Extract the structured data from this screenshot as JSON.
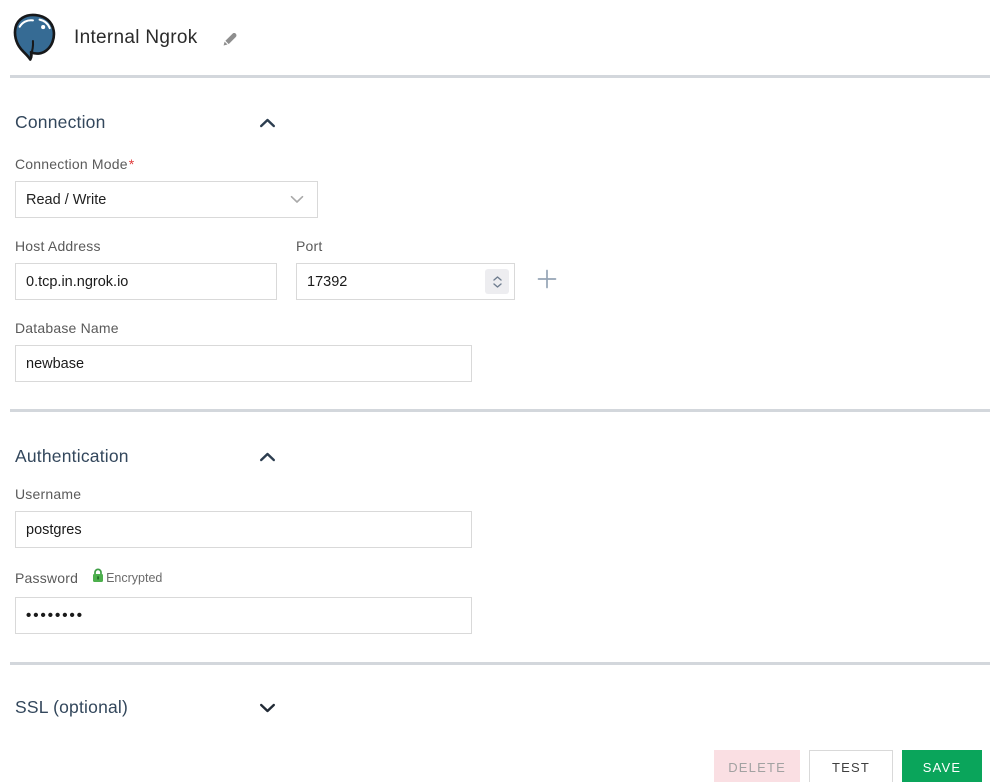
{
  "header": {
    "title": "Internal Ngrok"
  },
  "sections": {
    "connection": {
      "title": "Connection",
      "fields": {
        "connection_mode": {
          "label": "Connection Mode",
          "required_marker": "*",
          "value": "Read / Write"
        },
        "host": {
          "label": "Host Address",
          "value": "0.tcp.in.ngrok.io"
        },
        "port": {
          "label": "Port",
          "value": "17392"
        },
        "database": {
          "label": "Database Name",
          "value": "newbase"
        }
      }
    },
    "authentication": {
      "title": "Authentication",
      "fields": {
        "username": {
          "label": "Username",
          "value": "postgres"
        },
        "password": {
          "label": "Password",
          "badge": "Encrypted",
          "value": "••••••••"
        }
      }
    },
    "ssl": {
      "title": "SSL (optional)"
    }
  },
  "footer": {
    "delete_label": "DELETE",
    "test_label": "TEST",
    "save_label": "SAVE"
  },
  "icons": {
    "logo": "postgresql-elephant",
    "edit": "pencil",
    "collapse": "chevron-up",
    "expand": "chevron-down",
    "add": "plus",
    "encrypted": "green-lock",
    "port": "number-stepper"
  },
  "colors": {
    "save_green": "#0aa55b",
    "delete_pink_bg": "#fadfe3",
    "heading_blue": "#33475c",
    "divider_gray": "#d3d7dc",
    "lock_green": "#4db04d",
    "asterisk_red": "#e03c3c",
    "postgres_blue": "#366b94"
  }
}
